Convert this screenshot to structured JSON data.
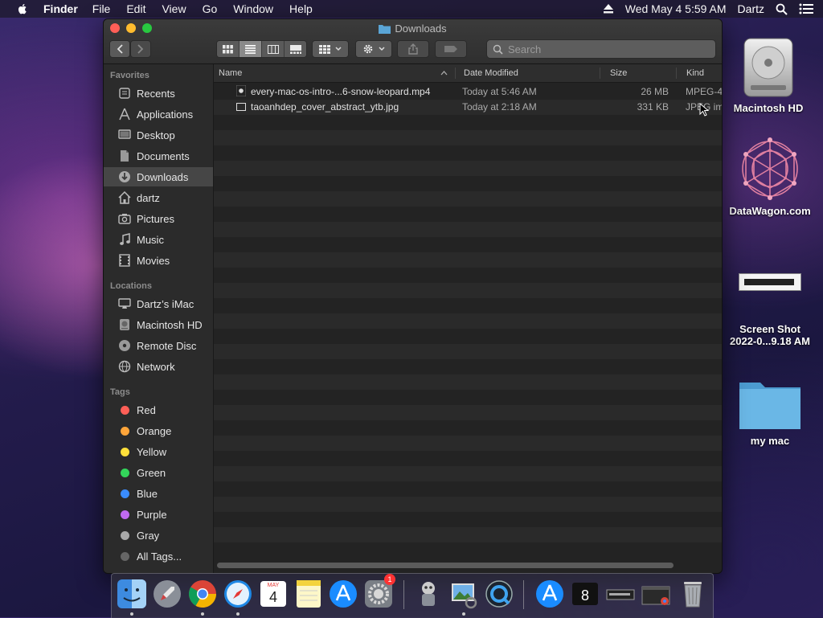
{
  "menubar": {
    "app": "Finder",
    "items": [
      "File",
      "Edit",
      "View",
      "Go",
      "Window",
      "Help"
    ],
    "clock": "Wed May 4  5:59 AM",
    "user": "Dartz"
  },
  "window": {
    "title": "Downloads",
    "search_placeholder": "Search"
  },
  "sidebar": {
    "favorites_label": "Favorites",
    "favorites": [
      {
        "label": "Recents",
        "icon": "recents-icon"
      },
      {
        "label": "Applications",
        "icon": "applications-icon"
      },
      {
        "label": "Desktop",
        "icon": "desktop-icon"
      },
      {
        "label": "Documents",
        "icon": "documents-icon"
      },
      {
        "label": "Downloads",
        "icon": "downloads-icon",
        "selected": true
      },
      {
        "label": "dartz",
        "icon": "home-icon"
      },
      {
        "label": "Pictures",
        "icon": "pictures-icon"
      },
      {
        "label": "Music",
        "icon": "music-icon"
      },
      {
        "label": "Movies",
        "icon": "movies-icon"
      }
    ],
    "locations_label": "Locations",
    "locations": [
      {
        "label": "Dartz’s iMac",
        "icon": "imac-icon"
      },
      {
        "label": "Macintosh HD",
        "icon": "hard-drive-icon"
      },
      {
        "label": "Remote Disc",
        "icon": "disc-icon"
      },
      {
        "label": "Network",
        "icon": "network-icon"
      }
    ],
    "tags_label": "Tags",
    "tags": [
      {
        "label": "Red",
        "color": "#ff5f57"
      },
      {
        "label": "Orange",
        "color": "#ffa53a"
      },
      {
        "label": "Yellow",
        "color": "#ffe03a"
      },
      {
        "label": "Green",
        "color": "#33d65a"
      },
      {
        "label": "Blue",
        "color": "#3a8cff"
      },
      {
        "label": "Purple",
        "color": "#c06af0"
      },
      {
        "label": "Gray",
        "color": "#a8a8a8"
      },
      {
        "label": "All Tags...",
        "color": "#666666"
      }
    ]
  },
  "columns": {
    "name": "Name",
    "date": "Date Modified",
    "size": "Size",
    "kind": "Kind"
  },
  "files": [
    {
      "name": "every-mac-os-intro-...6-snow-leopard.mp4",
      "date": "Today at 5:46 AM",
      "size": "26 MB",
      "kind": "MPEG-4",
      "icon": "video-file-icon"
    },
    {
      "name": "taoanhdep_cover_abstract_ytb.jpg",
      "date": "Today at 2:18 AM",
      "size": "331 KB",
      "kind": "JPEG im",
      "icon": "image-file-icon"
    }
  ],
  "desktop": [
    {
      "label": "Macintosh HD",
      "icon": "hard-drive-icon"
    },
    {
      "label": "DataWagon.com",
      "icon": "abstract-image-icon"
    },
    {
      "label": "Screen Shot",
      "label2": "2022-0...9.18 AM",
      "icon": "screenshot-thumbnail-icon"
    },
    {
      "label": "my mac",
      "icon": "folder-icon"
    }
  ],
  "dock": {
    "items": [
      "Finder",
      "Launchpad",
      "Chrome",
      "Safari",
      "Calendar",
      "Notes",
      "App Store",
      "System Preferences",
      "Automator",
      "Preview",
      "QuickTime Player",
      "App Store",
      "Terminal",
      "Screenshot",
      "Chrome Window",
      "Trash"
    ],
    "calendar_month": "MAY",
    "calendar_day": "4",
    "settings_badge": "1"
  }
}
